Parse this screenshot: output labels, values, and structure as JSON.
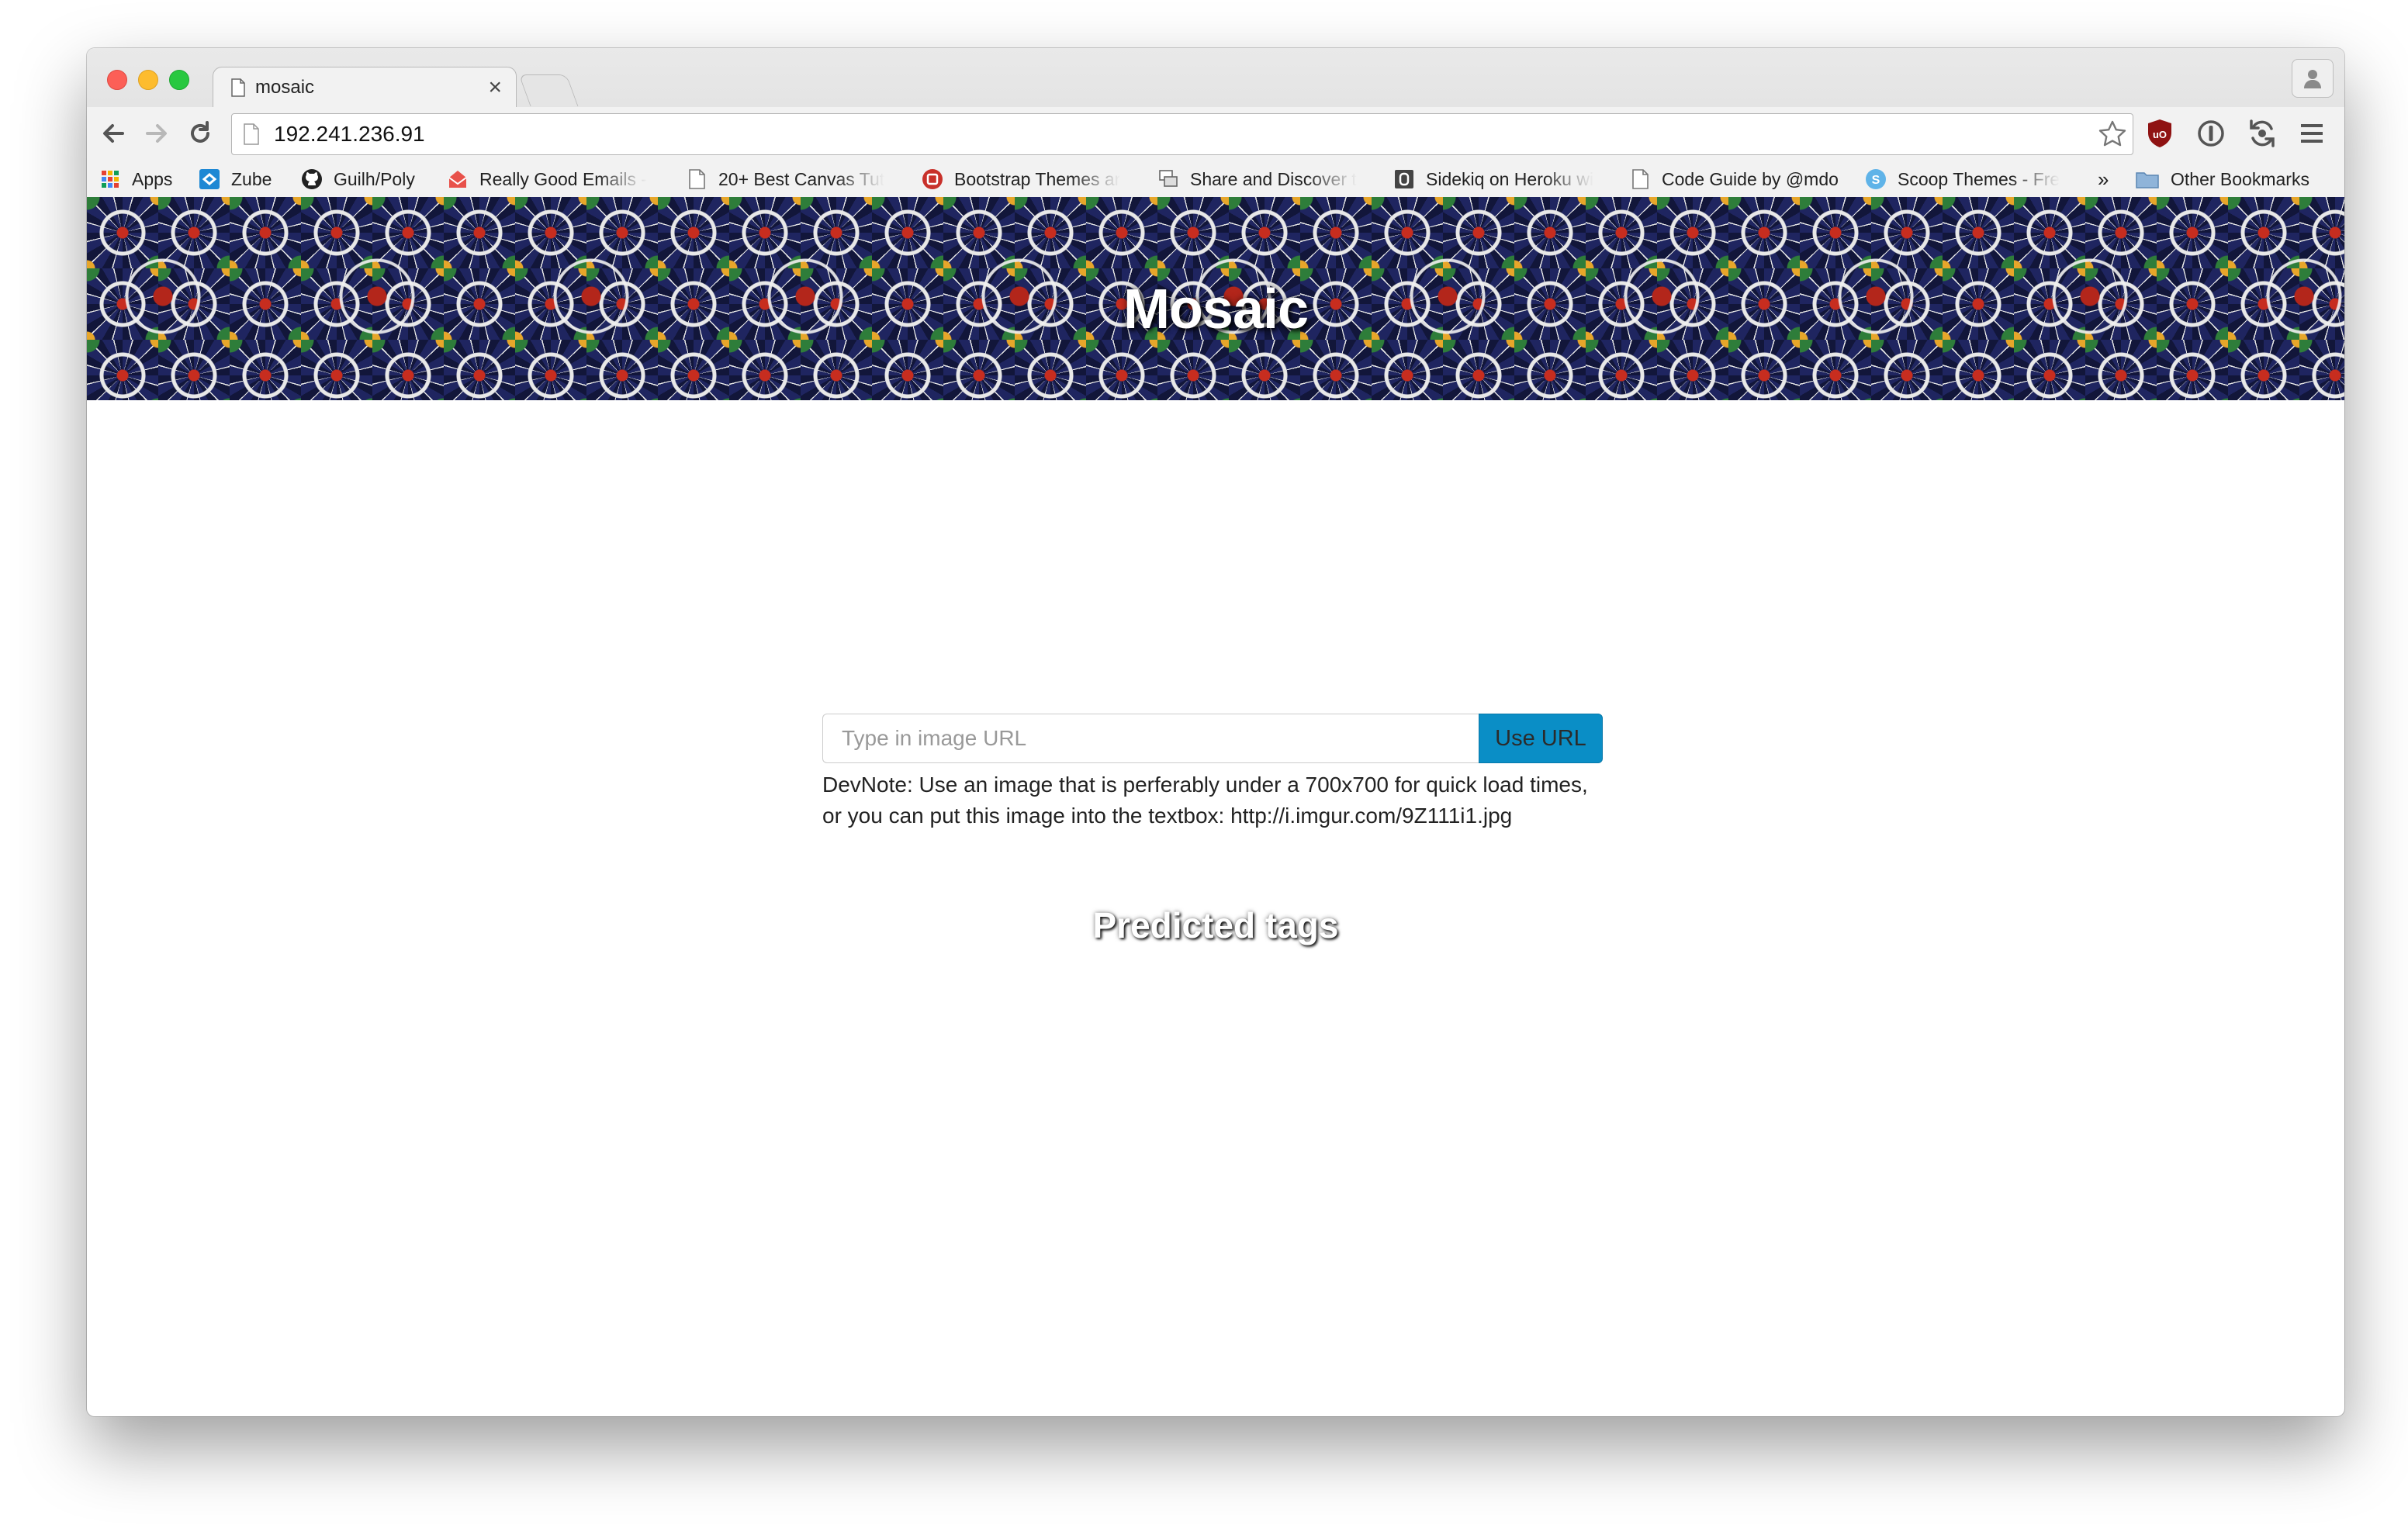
{
  "browser": {
    "tab_title": "mosaic",
    "tab_close": "×",
    "address": "192.241.236.91",
    "bookmarks": [
      {
        "label": "Apps",
        "icon": "apps-grid-icon"
      },
      {
        "label": "Zube",
        "icon": "zube-icon"
      },
      {
        "label": "Guilh/Poly",
        "icon": "github-icon"
      },
      {
        "label": "Really Good Emails -",
        "icon": "envelope-icon"
      },
      {
        "label": "20+ Best Canvas Tut",
        "icon": "page-icon"
      },
      {
        "label": "Bootstrap Themes ar",
        "icon": "bootstrap-icon"
      },
      {
        "label": "Share and Discover t",
        "icon": "share-icon"
      },
      {
        "label": "Sidekiq on Heroku wi",
        "icon": "sidekiq-icon"
      },
      {
        "label": "Code Guide by @mdo",
        "icon": "page-icon"
      },
      {
        "label": "Scoop Themes - Fre",
        "icon": "scoop-icon"
      }
    ],
    "overflow": "»",
    "other_bookmarks": "Other Bookmarks"
  },
  "page": {
    "title": "Mosaic",
    "input_placeholder": "Type in image URL",
    "button_label": "Use URL",
    "devnote_line1": "DevNote: Use an image that is perferably under a 700x700 for quick load times,",
    "devnote_line2": "or you can put this image into the textbox: http://i.imgur.com/9Z111i1.jpg",
    "tags_heading": "Predicted tags"
  },
  "colors": {
    "button": "#0a8ec6",
    "banner_base": "#26306e"
  }
}
